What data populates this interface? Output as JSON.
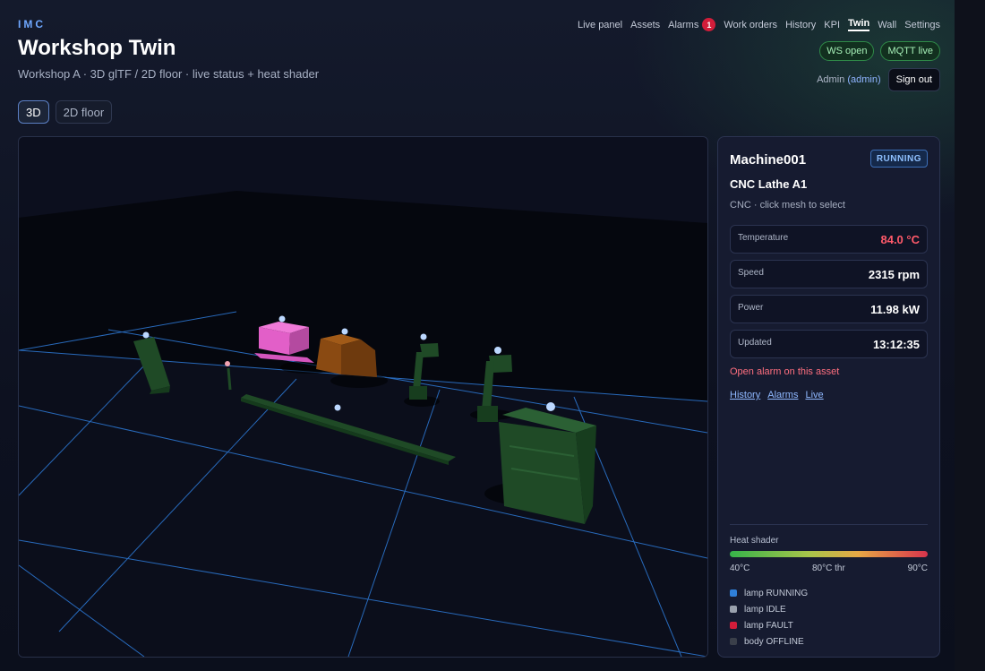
{
  "app": {
    "brand": "IMC",
    "title": "Workshop Twin",
    "subtitle": "Workshop A · 3D glTF / 2D floor · live status + heat shader"
  },
  "view_tabs": [
    {
      "label": "3D",
      "active": true
    },
    {
      "label": "2D floor",
      "active": false
    }
  ],
  "nav": {
    "items": [
      {
        "label": "Live panel"
      },
      {
        "label": "Assets"
      },
      {
        "label": "Alarms",
        "badge": "1"
      },
      {
        "label": "Work orders"
      },
      {
        "label": "History"
      },
      {
        "label": "KPI"
      },
      {
        "label": "Twin",
        "active": true
      },
      {
        "label": "Wall"
      },
      {
        "label": "Settings"
      }
    ],
    "pills": [
      "WS open",
      "MQTT live"
    ],
    "user": {
      "name": "Admin",
      "role": "(admin)",
      "signout": "Sign out"
    }
  },
  "asset": {
    "id": "Machine001",
    "status": "RUNNING",
    "name": "CNC Lathe A1",
    "description": "CNC · click mesh to select",
    "metrics": [
      {
        "label": "Temperature",
        "value": "84.0 °C",
        "hot": true
      },
      {
        "label": "Speed",
        "value": "2315 rpm"
      },
      {
        "label": "Power",
        "value": "11.98 kW"
      },
      {
        "label": "Updated",
        "value": "13:12:35"
      }
    ],
    "alarm_text": "Open alarm on this asset",
    "links": [
      "History",
      "Alarms",
      "Live"
    ]
  },
  "heat_shader": {
    "title": "Heat shader",
    "min_label": "40°C",
    "threshold_label": "80°C thr",
    "max_label": "90°C",
    "colors": [
      "#36b34a",
      "#a8c54a",
      "#e7a845",
      "#d8344c"
    ]
  },
  "legend": [
    {
      "label": "lamp RUNNING",
      "color": "#2f7fd8"
    },
    {
      "label": "lamp IDLE",
      "color": "#9aa1ad"
    },
    {
      "label": "lamp FAULT",
      "color": "#d21d3a"
    },
    {
      "label": "body OFFLINE",
      "color": "#3a3f4a"
    }
  ],
  "scene_colors": {
    "machine_green": "#1f4a26",
    "machine_pink": "#e25fc8",
    "machine_orange": "#8a4a12",
    "grid_line": "#2a6fc4",
    "status_lamp": "#bcd8ff"
  }
}
